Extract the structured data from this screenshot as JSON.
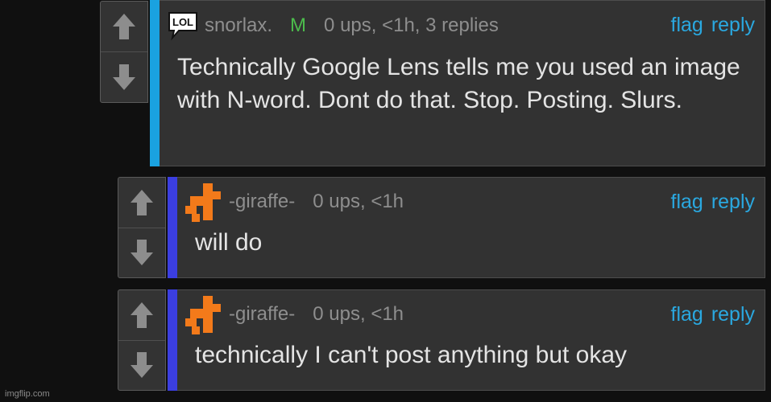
{
  "colors": {
    "bar_op": "#1aa2e0",
    "bar_reply": "#3b3ee0",
    "link": "#2aa8e0",
    "mod": "#4cbb4c"
  },
  "labels": {
    "flag": "flag",
    "reply": "reply"
  },
  "comments": [
    {
      "username": "snorlax.",
      "badge": "M",
      "meta": "0 ups, <1h, 3 replies",
      "avatar": "lol-speech-bubble-icon",
      "text": "Technically Google Lens tells me you used an image with N-word. Dont do that. Stop. Posting. Slurs."
    },
    {
      "username": "-giraffe-",
      "meta": "0 ups, <1h",
      "avatar": "orange-giraffe-icon",
      "text": "will do"
    },
    {
      "username": "-giraffe-",
      "meta": "0 ups, <1h",
      "avatar": "orange-giraffe-icon",
      "text": "technically I can't post anything but okay"
    }
  ],
  "watermark": "imgflip.com"
}
